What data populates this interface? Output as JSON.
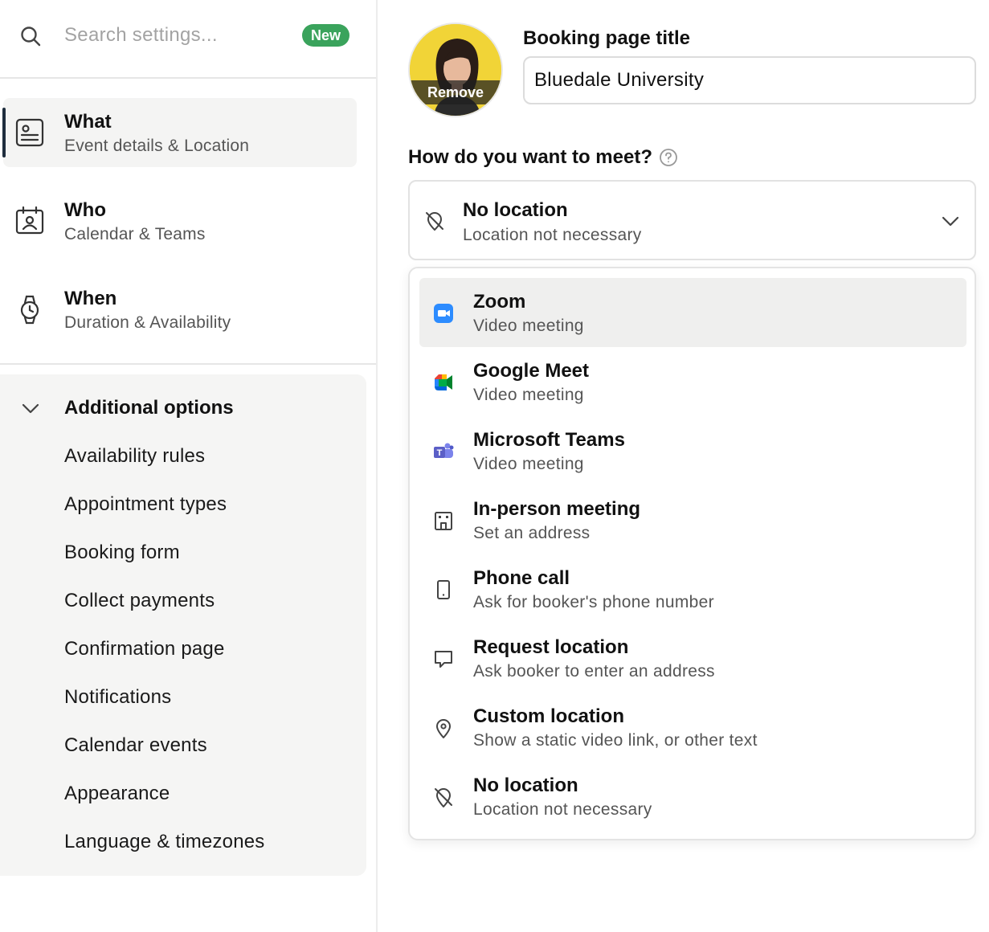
{
  "search": {
    "placeholder": "Search settings...",
    "badge": "New",
    "icon": "search-icon"
  },
  "nav": [
    {
      "title": "What",
      "subtitle": "Event details & Location",
      "icon": "event-details-icon",
      "active": true
    },
    {
      "title": "Who",
      "subtitle": "Calendar & Teams",
      "icon": "calendar-person-icon",
      "active": false
    },
    {
      "title": "When",
      "subtitle": "Duration & Availability",
      "icon": "watch-icon",
      "active": false
    }
  ],
  "additional": {
    "label": "Additional options",
    "items": [
      "Availability rules",
      "Appointment types",
      "Booking form",
      "Collect payments",
      "Confirmation page",
      "Notifications",
      "Calendar events",
      "Appearance",
      "Language & timezones"
    ]
  },
  "avatar": {
    "remove_label": "Remove"
  },
  "booking": {
    "label": "Booking page title",
    "value": "Bluedale University"
  },
  "meet": {
    "label": "How do you want to meet?",
    "selected": {
      "title": "No location",
      "subtitle": "Location not necessary"
    },
    "options": [
      {
        "title": "Zoom",
        "subtitle": "Video meeting",
        "icon": "zoom-icon"
      },
      {
        "title": "Google Meet",
        "subtitle": "Video meeting",
        "icon": "google-meet-icon"
      },
      {
        "title": "Microsoft Teams",
        "subtitle": "Video meeting",
        "icon": "microsoft-teams-icon"
      },
      {
        "title": "In-person meeting",
        "subtitle": "Set an address",
        "icon": "building-icon"
      },
      {
        "title": "Phone call",
        "subtitle": "Ask for booker's phone number",
        "icon": "phone-icon"
      },
      {
        "title": "Request location",
        "subtitle": "Ask booker to enter an address",
        "icon": "speech-bubble-icon"
      },
      {
        "title": "Custom location",
        "subtitle": "Show a static video link, or other text",
        "icon": "map-pin-icon"
      },
      {
        "title": "No location",
        "subtitle": "Location not necessary",
        "icon": "no-location-icon"
      }
    ]
  },
  "colors": {
    "accent_green": "#3aa35c",
    "active_bar": "#1f2d3d",
    "avatar_bg": "#f1d437",
    "zoom_blue": "#2d8cff",
    "teams_purple": "#5b5fc7"
  }
}
